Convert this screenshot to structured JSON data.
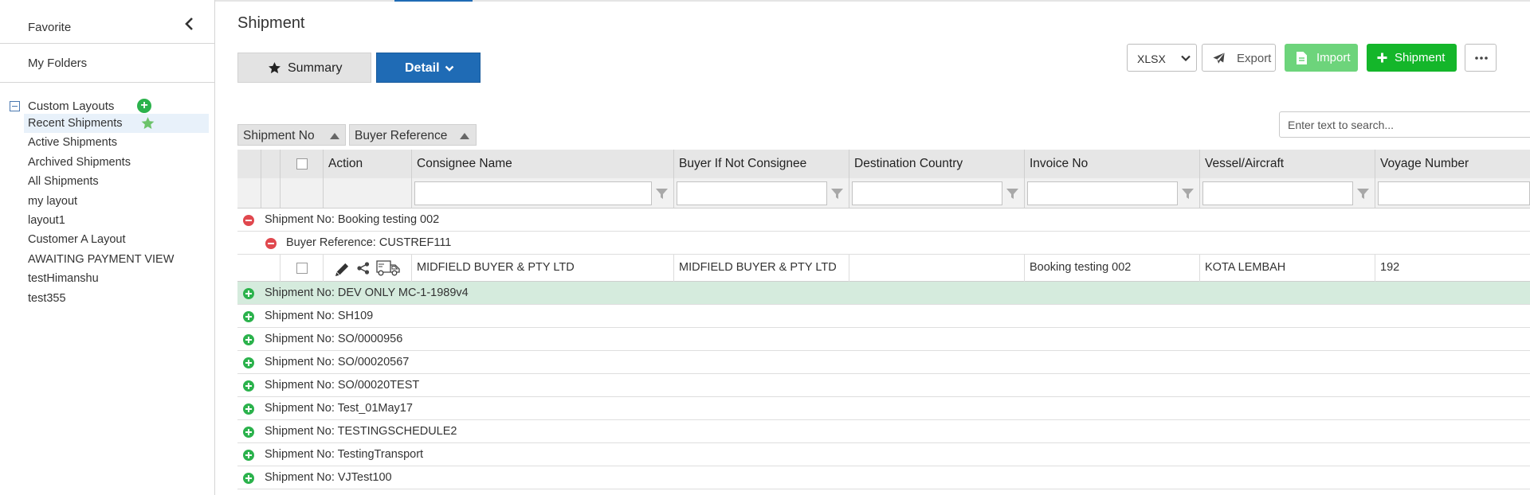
{
  "sidebar": {
    "favorite_label": "Favorite",
    "my_folders_label": "My Folders",
    "custom_layouts_label": "Custom Layouts",
    "add_symbol": "+",
    "layouts": [
      "Recent Shipments",
      "Active Shipments",
      "Archived Shipments",
      "All Shipments",
      "my layout",
      "layout1",
      "Customer A Layout",
      "AWAITING PAYMENT VIEW",
      "testHimanshu",
      "test355"
    ],
    "active_layout": "Recent Shipments"
  },
  "header": {
    "title": "Shipment",
    "summary_label": "Summary",
    "detail_label": "Detail",
    "format_value": "XLSX",
    "export_label": "Export",
    "import_label": "Import",
    "add_shipment_label": "Shipment"
  },
  "search": {
    "placeholder": "Enter text to search..."
  },
  "grouping": {
    "chip_1": "Shipment No",
    "chip_2": "Buyer Reference"
  },
  "grid": {
    "columns": {
      "action": "Action",
      "consignee_name": "Consignee Name",
      "buyer_if_not_consignee": "Buyer If Not Consignee",
      "destination_country": "Destination Country",
      "invoice_no": "Invoice No",
      "vessel_aircraft": "Vessel/Aircraft",
      "voyage_number": "Voyage Number"
    },
    "expanded_group": "Shipment No: Booking testing 002",
    "sub_group": "Buyer Reference: CUSTREF111",
    "data_row": {
      "consignee_name": "MIDFIELD BUYER & PTY LTD",
      "buyer_if_not_consignee": "MIDFIELD BUYER & PTY LTD",
      "destination_country": "",
      "invoice_no": "Booking testing 002",
      "vessel_aircraft": "KOTA LEMBAH",
      "voyage_number": "192"
    },
    "collapsed_groups": [
      "Shipment No: DEV ONLY MC-1-1989v4",
      "Shipment No: SH109",
      "Shipment No: SO/0000956",
      "Shipment No: SO/00020567",
      "Shipment No: SO/00020TEST",
      "Shipment No: Test_01May17",
      "Shipment No: TESTINGSCHEDULE2",
      "Shipment No: TestingTransport",
      "Shipment No: VJTest100"
    ],
    "selected_group_index": 0
  },
  "colors": {
    "primary_blue": "#1f6bb5",
    "import_green": "#6dd47b",
    "add_green": "#14b62a",
    "selected_row": "#d5ebdd",
    "collapse_red": "#e0484e",
    "expand_green": "#2bb24c",
    "favorite_star": "#6cc36a"
  },
  "icons": {
    "collapse_sidebar": "chevron-left-icon",
    "star": "star-icon",
    "detail_dropdown": "chevron-down-icon",
    "export": "paper-plane-icon",
    "import": "file-icon",
    "add": "plus-icon",
    "more": "ellipsis-icon",
    "sort": "triangle-up-icon",
    "filter": "funnel-icon",
    "edit": "pencil-icon",
    "share": "share-icon",
    "transport": "truck-icon",
    "group_expand": "plus-circle-icon",
    "group_collapse": "minus-circle-icon"
  }
}
